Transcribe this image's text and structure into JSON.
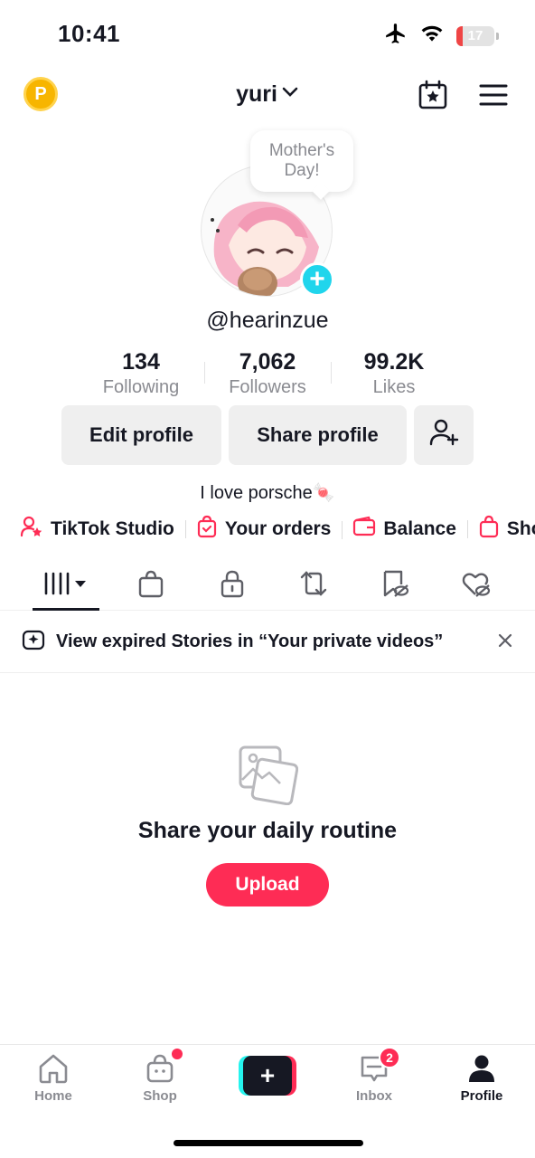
{
  "status_bar": {
    "time": "10:41",
    "battery_level": "17",
    "icons": [
      "airplane-icon",
      "wifi-icon",
      "battery-icon"
    ]
  },
  "top_nav": {
    "coin_label": "P",
    "username": "yuri",
    "icons": [
      "calendar-star-icon",
      "menu-icon"
    ]
  },
  "profile": {
    "bubble_text": "Mother's Day!",
    "handle": "@hearinzue",
    "bio": "I love porsche🍬"
  },
  "stats": [
    {
      "value": "134",
      "label": "Following"
    },
    {
      "value": "7,062",
      "label": "Followers"
    },
    {
      "value": "99.2K",
      "label": "Likes"
    }
  ],
  "actions": {
    "edit_profile": "Edit profile",
    "share_profile": "Share profile"
  },
  "quick_links": [
    {
      "label": "TikTok Studio",
      "icon": "studio-icon"
    },
    {
      "label": "Your orders",
      "icon": "orders-icon"
    },
    {
      "label": "Balance",
      "icon": "wallet-icon"
    },
    {
      "label": "Show",
      "icon": "bag-icon"
    }
  ],
  "tabs": [
    "videos-grid",
    "shop-bag",
    "private-lock",
    "reposts",
    "favorites",
    "liked"
  ],
  "banner": {
    "text": "View expired Stories in “Your private videos”"
  },
  "empty_state": {
    "title": "Share your daily routine",
    "button": "Upload"
  },
  "bottom_nav": {
    "home": "Home",
    "shop": "Shop",
    "create": "+",
    "inbox": "Inbox",
    "inbox_badge": "2",
    "profile": "Profile"
  },
  "colors": {
    "accent": "#fe2c55",
    "cyan": "#20d5ec",
    "text": "#161823",
    "muted": "#8a8b91"
  }
}
